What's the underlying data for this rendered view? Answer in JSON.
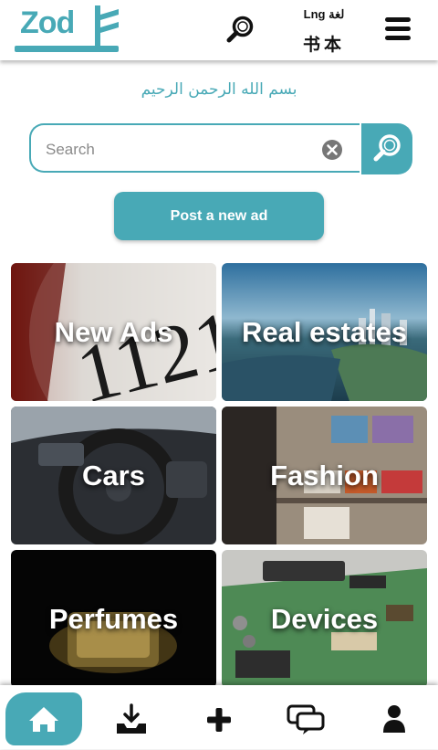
{
  "header": {
    "logo_text": "Zod",
    "lng_label": "Lng لغة",
    "lng_chinese": "书本"
  },
  "bismillah": "بسم الله الرحمن الرحيم",
  "search": {
    "placeholder": "Search",
    "value": ""
  },
  "post_button_label": "Post a new ad",
  "categories": [
    {
      "label": "New Ads"
    },
    {
      "label": "Real estates"
    },
    {
      "label": "Cars"
    },
    {
      "label": "Fashion"
    },
    {
      "label": "Perfumes"
    },
    {
      "label": "Devices"
    }
  ],
  "bottom_nav": [
    {
      "icon": "home-icon",
      "active": true
    },
    {
      "icon": "inbox-download-icon",
      "active": false
    },
    {
      "icon": "plus-icon",
      "active": false
    },
    {
      "icon": "chat-icon",
      "active": false
    },
    {
      "icon": "user-icon",
      "active": false
    }
  ],
  "colors": {
    "accent": "#48a9b6",
    "background": "#ffffff"
  }
}
